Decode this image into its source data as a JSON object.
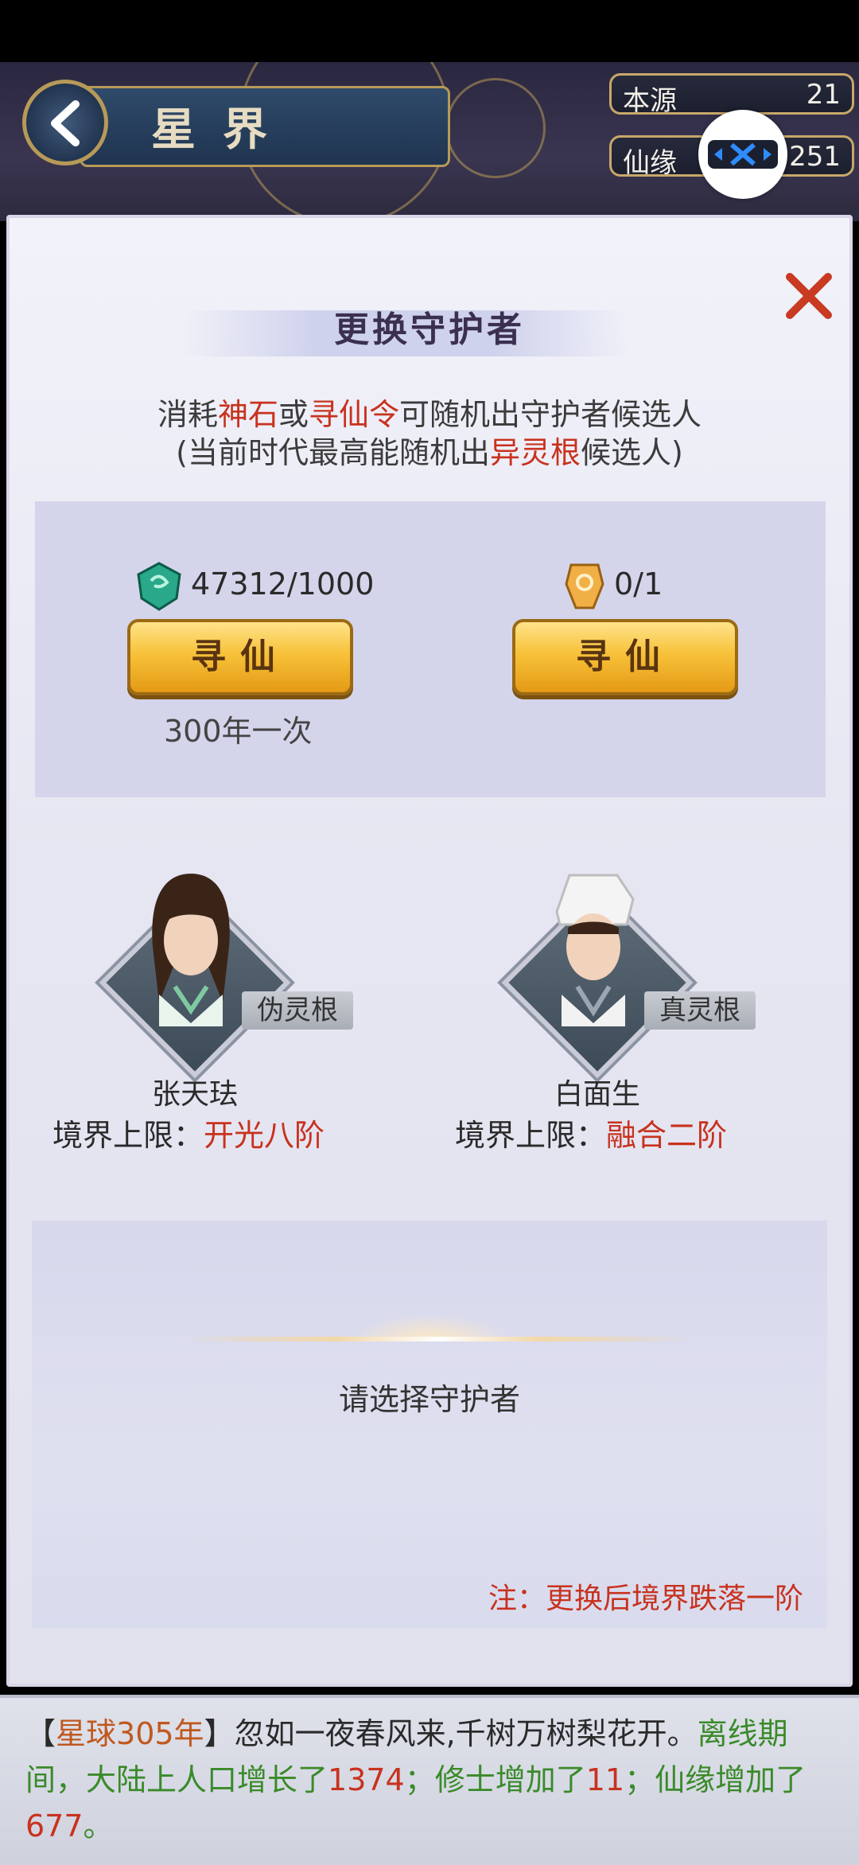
{
  "header": {
    "title": "星界",
    "resources": [
      {
        "label": "本源",
        "value": "21"
      },
      {
        "label": "仙缘",
        "value": "3251"
      }
    ]
  },
  "dialog": {
    "title": "更换守护者",
    "desc_line1": {
      "pre": "消耗",
      "item1": "神石",
      "mid": "或",
      "item2": "寻仙令",
      "post": "可随机出守护者候选人"
    },
    "desc_line2": {
      "pre": "(当前时代最高能随机出",
      "highlight": "异灵根",
      "post": "候选人)"
    },
    "left_cost": "47312/1000",
    "right_cost": "0/1",
    "seek_button_label": "寻仙",
    "cooldown": "300年一次",
    "candidates": [
      {
        "name": "张天珐",
        "root": "伪灵根",
        "realm_label": "境界上限：",
        "realm_value": "开光八阶"
      },
      {
        "name": "白面生",
        "root": "真灵根",
        "realm_label": "境界上限：",
        "realm_value": "融合二阶"
      }
    ],
    "choose_prompt": "请选择守护者",
    "note": "注：更换后境界跌落一阶"
  },
  "log": {
    "bracket_open": "【",
    "year": "星球305年",
    "bracket_close": "】",
    "text": "忽如一夜春风来,千树万树梨花开。",
    "offline_prefix": "离线期间，大陆上人口增长了",
    "population": "1374",
    "sep1": "；修士增加了",
    "cultivators": "11",
    "sep2": "；仙缘增加了",
    "fate": "677",
    "end": "。"
  },
  "colors": {
    "accent_red": "#c8321e",
    "accent_green": "#3a8a2a",
    "gold_button": "#f7c23a"
  }
}
